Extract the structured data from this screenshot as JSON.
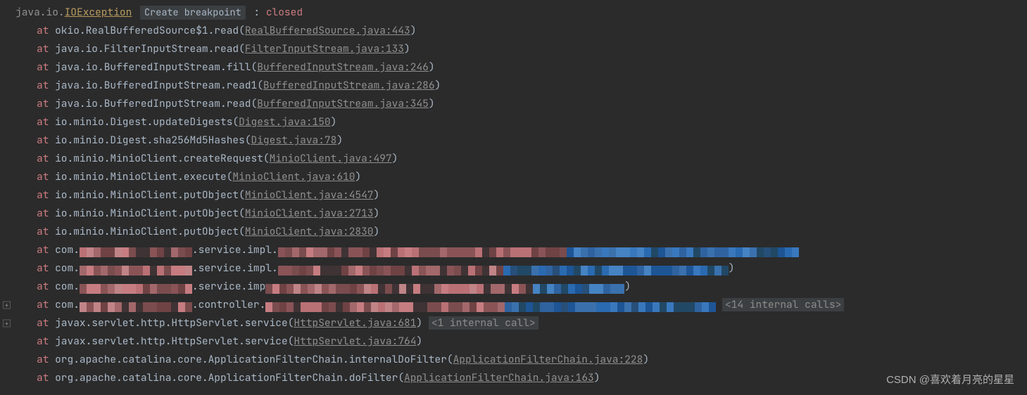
{
  "header": {
    "pkg": "java.io.",
    "exception": "IOException",
    "create_bp": "Create breakpoint",
    "colon": " : ",
    "message": "closed"
  },
  "frames": [
    {
      "at": "at ",
      "qual": "okio.RealBufferedSource$1.read",
      "link": "RealBufferedSource.java:443",
      "paren_close": ")"
    },
    {
      "at": "at ",
      "qual": "java.io.FilterInputStream.read",
      "link": "FilterInputStream.java:133",
      "paren_close": ")"
    },
    {
      "at": "at ",
      "qual": "java.io.BufferedInputStream.fill",
      "link": "BufferedInputStream.java:246",
      "paren_close": ")"
    },
    {
      "at": "at ",
      "qual": "java.io.BufferedInputStream.read1",
      "link": "BufferedInputStream.java:286",
      "paren_close": ")"
    },
    {
      "at": "at ",
      "qual": "java.io.BufferedInputStream.read",
      "link": "BufferedInputStream.java:345",
      "paren_close": ")"
    },
    {
      "at": "at ",
      "qual": "io.minio.Digest.updateDigests",
      "link": "Digest.java:150",
      "paren_close": ")"
    },
    {
      "at": "at ",
      "qual": "io.minio.Digest.sha256Md5Hashes",
      "link": "Digest.java:78",
      "paren_close": ")"
    },
    {
      "at": "at ",
      "qual": "io.minio.MinioClient.createRequest",
      "link": "MinioClient.java:497",
      "paren_close": ")"
    },
    {
      "at": "at ",
      "qual": "io.minio.MinioClient.execute",
      "link": "MinioClient.java:610",
      "paren_close": ")"
    },
    {
      "at": "at ",
      "qual": "io.minio.MinioClient.putObject",
      "link": "MinioClient.java:4547",
      "paren_close": ")"
    },
    {
      "at": "at ",
      "qual": "io.minio.MinioClient.putObject",
      "link": "MinioClient.java:2713",
      "paren_close": ")"
    },
    {
      "at": "at ",
      "qual": "io.minio.MinioClient.putObject",
      "link": "MinioClient.java:2830",
      "paren_close": ")"
    },
    {
      "at": "at ",
      "qual_prefix": "com.",
      "qual_suffix": ".service.impl.",
      "redacted_red_w": 590,
      "redacted_blue_w": 330,
      "paren_close": ")",
      "no_paren": true
    },
    {
      "at": "at ",
      "qual_prefix": "com.",
      "qual_suffix": ".service.impl.",
      "redacted_red_w": 500,
      "redacted_blue_w": 320,
      "paren_close": ")"
    },
    {
      "at": "at ",
      "qual_prefix": "com.",
      "qual_suffix": ".service.imp",
      "redacted_red_w": 560,
      "redacted_blue_w": 130,
      "paren_close": ")"
    },
    {
      "at": "at ",
      "qual_prefix": "com.",
      "qual_suffix": ".controller.",
      "redacted_red_w": 520,
      "redacted_blue_w": 300,
      "paren_close": ")",
      "no_paren": true,
      "internal": "<14 internal calls>",
      "expand": true
    },
    {
      "at": "at ",
      "qual": "javax.servlet.http.HttpServlet.service",
      "link": "HttpServlet.java:681",
      "paren_close": ")",
      "internal": "<1 internal call>",
      "expand": true
    },
    {
      "at": "at ",
      "qual": "javax.servlet.http.HttpServlet.service",
      "link": "HttpServlet.java:764",
      "paren_close": ")"
    },
    {
      "at": "at ",
      "qual": "org.apache.catalina.core.ApplicationFilterChain.internalDoFilter",
      "link": "ApplicationFilterChain.java:228",
      "paren_close": ")"
    },
    {
      "at": "at ",
      "qual": "org.apache.catalina.core.ApplicationFilterChain.doFilter",
      "link": "ApplicationFilterChain.java:163",
      "paren_close": ")"
    }
  ],
  "watermark": "CSDN @喜欢着月亮的星星",
  "glyphs": {
    "expand": "+"
  },
  "paren_open": "("
}
